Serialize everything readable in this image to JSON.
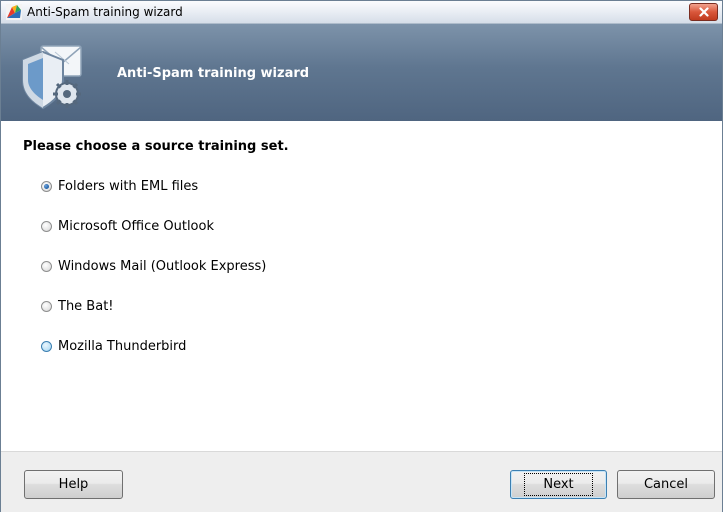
{
  "window": {
    "title": "Anti-Spam training wizard",
    "close_icon": "close-icon"
  },
  "header": {
    "title": "Anti-Spam training wizard",
    "icon": "shield-mail-gear-icon"
  },
  "content": {
    "prompt": "Please choose a source training set.",
    "options": [
      {
        "label": "Folders with EML files",
        "selected": true
      },
      {
        "label": "Microsoft Office Outlook",
        "selected": false
      },
      {
        "label": "Windows Mail (Outlook Express)",
        "selected": false
      },
      {
        "label": "The Bat!",
        "selected": false
      },
      {
        "label": "Mozilla Thunderbird",
        "selected": false,
        "hovered": true
      }
    ]
  },
  "footer": {
    "help_label": "Help",
    "next_label": "Next",
    "cancel_label": "Cancel"
  },
  "colors": {
    "header_bg": "#5f7690",
    "close_button": "#c03b1f",
    "selected_radio": "#1d5fa8"
  }
}
